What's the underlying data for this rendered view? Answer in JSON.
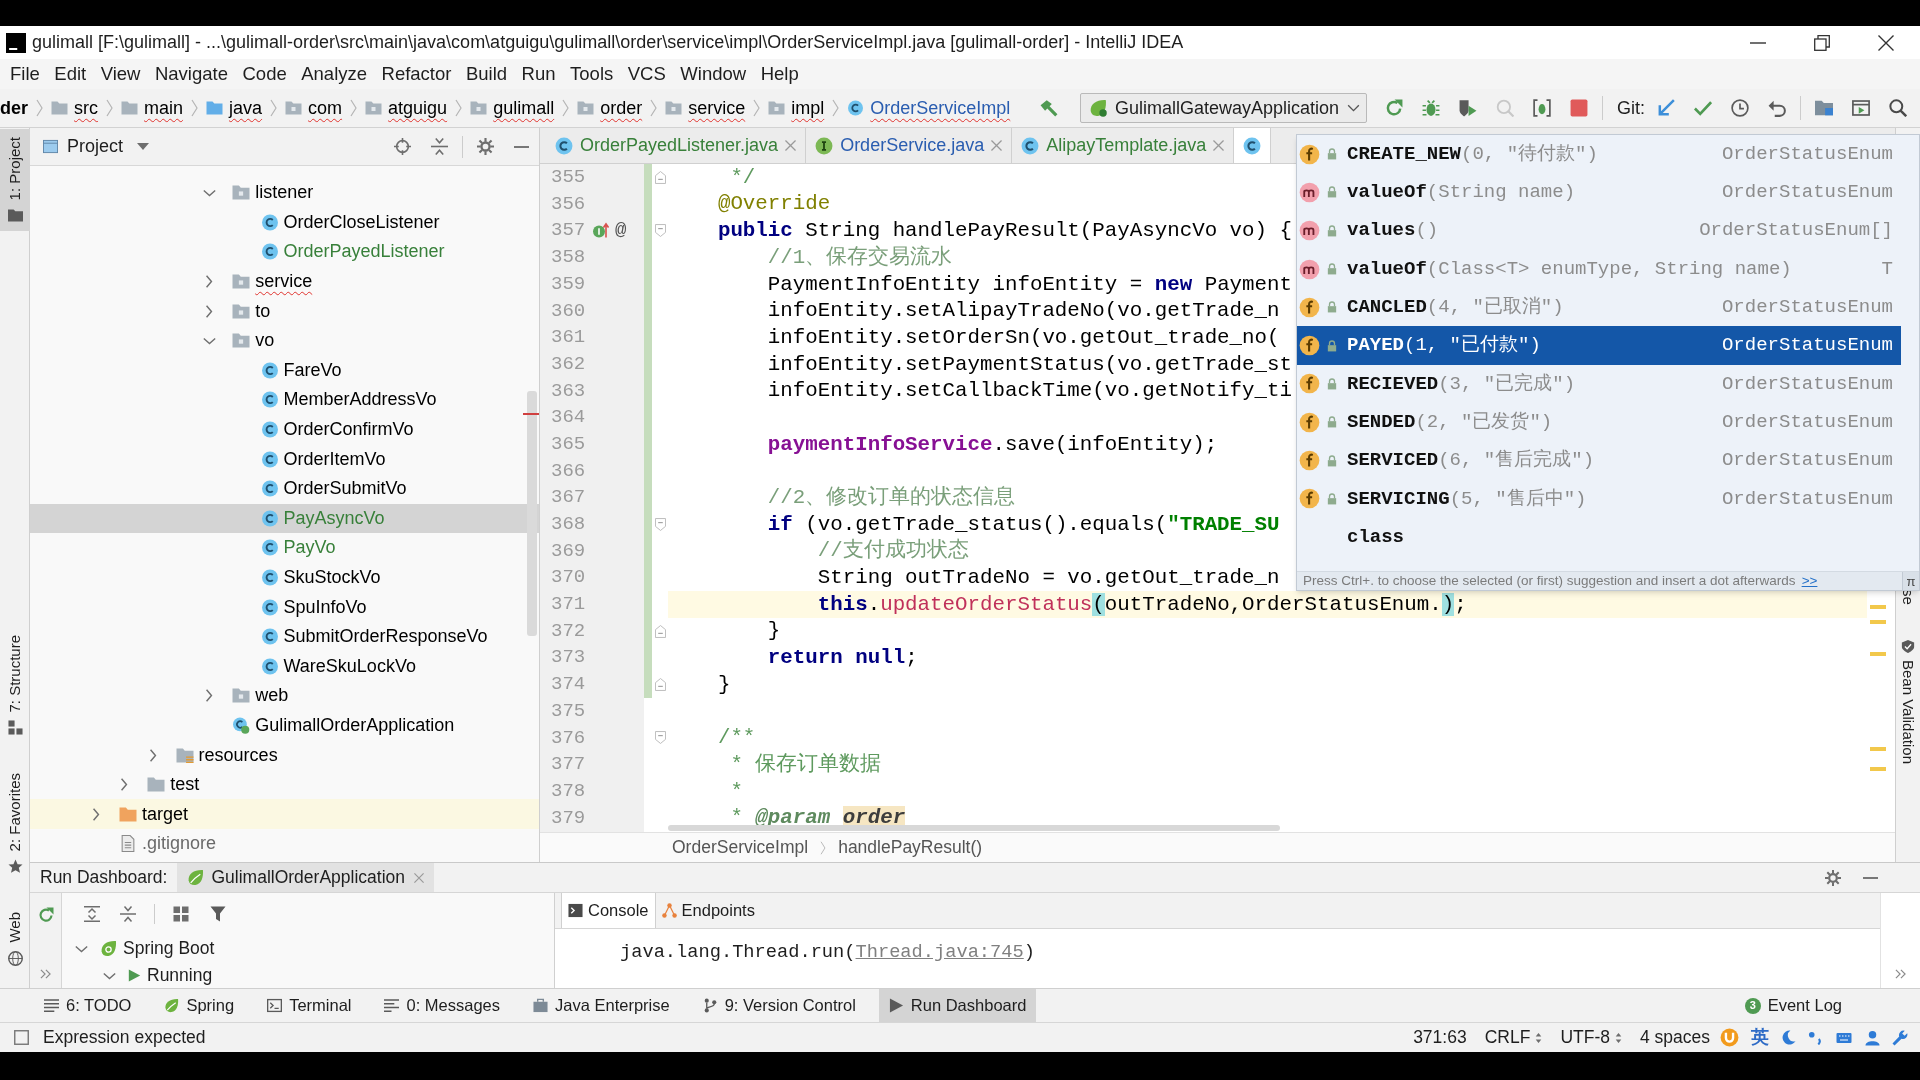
{
  "window": {
    "title": "gulimall [F:\\gulimall] - ...\\gulimall-order\\src\\main\\java\\com\\atguigu\\gulimall\\order\\service\\impl\\OrderServiceImpl.java [gulimall-order] - IntelliJ IDEA"
  },
  "menu": [
    "File",
    "Edit",
    "View",
    "Navigate",
    "Code",
    "Analyze",
    "Refactor",
    "Build",
    "Run",
    "Tools",
    "VCS",
    "Window",
    "Help"
  ],
  "navigation_bar": [
    {
      "label": "der",
      "kind": "module",
      "error": false,
      "color": "#000000"
    },
    {
      "label": "src",
      "kind": "folder",
      "error": true,
      "color": "#000000"
    },
    {
      "label": "main",
      "kind": "folder",
      "error": true,
      "color": "#000000"
    },
    {
      "label": "java",
      "kind": "source_folder",
      "error": true,
      "color": "#000000"
    },
    {
      "label": "com",
      "kind": "package",
      "error": true,
      "color": "#000000"
    },
    {
      "label": "atguigu",
      "kind": "package",
      "error": true,
      "color": "#000000"
    },
    {
      "label": "gulimall",
      "kind": "package",
      "error": true,
      "color": "#000000"
    },
    {
      "label": "order",
      "kind": "package",
      "error": true,
      "color": "#000000"
    },
    {
      "label": "service",
      "kind": "package",
      "error": true,
      "color": "#000000"
    },
    {
      "label": "impl",
      "kind": "package",
      "error": true,
      "color": "#000000"
    },
    {
      "label": "OrderServiceImpl",
      "kind": "class",
      "error": true,
      "color": "#2a5db0"
    }
  ],
  "toolbar": {
    "run_configuration": "GulimallGatewayApplication",
    "run_buttons": [
      {
        "kind": "rerun",
        "disabled": false
      },
      {
        "kind": "debug",
        "disabled": false
      },
      {
        "kind": "coverage",
        "disabled": false
      },
      {
        "kind": "profile",
        "disabled": true
      },
      {
        "kind": "attach",
        "disabled": false
      },
      {
        "kind": "stop",
        "disabled": false
      }
    ],
    "vcs_label": "Git:",
    "vcs_buttons": [
      {
        "kind": "update"
      },
      {
        "kind": "commit"
      },
      {
        "kind": "history"
      },
      {
        "kind": "rollback"
      }
    ],
    "tool_buttons": [
      {
        "kind": "project_structure"
      },
      {
        "kind": "presentation"
      },
      {
        "kind": "search"
      }
    ]
  },
  "left_strip": [
    {
      "label": "1: Project",
      "kind": "project",
      "selected": true
    },
    {
      "label": "7: Structure",
      "kind": "structure",
      "selected": false
    },
    {
      "label": "2: Favorites",
      "kind": "favorites",
      "selected": false
    },
    {
      "label": "Web",
      "kind": "web",
      "selected": false
    }
  ],
  "project_panel": {
    "title": "Project",
    "tree": [
      {
        "children": [
          {
            "children": [
              {
                "children": [
                  {
                    "children": [
                      {
                        "label": "listener",
                        "kind": "package",
                        "expanded": true,
                        "selected": false,
                        "error": false,
                        "color": "#000000",
                        "children": [
                          {
                            "label": "OrderCloseListener",
                            "kind": "class",
                            "selected": false,
                            "error": false,
                            "color": "#000000"
                          },
                          {
                            "label": "OrderPayedListener",
                            "kind": "class",
                            "selected": false,
                            "error": false,
                            "color": "#38803a"
                          }
                        ]
                      },
                      {
                        "label": "service",
                        "kind": "package",
                        "expanded": false,
                        "selected": false,
                        "error": true,
                        "color": "#000000"
                      },
                      {
                        "label": "to",
                        "kind": "package",
                        "expanded": false,
                        "selected": false,
                        "error": false,
                        "color": "#000000"
                      },
                      {
                        "label": "vo",
                        "kind": "package",
                        "expanded": true,
                        "selected": false,
                        "error": false,
                        "color": "#000000",
                        "children": [
                          {
                            "label": "FareVo",
                            "kind": "class",
                            "selected": false,
                            "error": false,
                            "color": "#000000"
                          },
                          {
                            "label": "MemberAddressVo",
                            "kind": "class",
                            "selected": false,
                            "error": false,
                            "color": "#000000"
                          },
                          {
                            "label": "OrderConfirmVo",
                            "kind": "class",
                            "selected": false,
                            "error": false,
                            "color": "#000000"
                          },
                          {
                            "label": "OrderItemVo",
                            "kind": "class",
                            "selected": false,
                            "error": false,
                            "color": "#000000"
                          },
                          {
                            "label": "OrderSubmitVo",
                            "kind": "class",
                            "selected": false,
                            "error": false,
                            "color": "#000000"
                          },
                          {
                            "label": "PayAsyncVo",
                            "kind": "class",
                            "selected": true,
                            "error": false,
                            "color": "#38803a"
                          },
                          {
                            "label": "PayVo",
                            "kind": "class",
                            "selected": false,
                            "error": false,
                            "color": "#38803a"
                          },
                          {
                            "label": "SkuStockVo",
                            "kind": "class",
                            "selected": false,
                            "error": false,
                            "color": "#000000"
                          },
                          {
                            "label": "SpuInfoVo",
                            "kind": "class",
                            "selected": false,
                            "error": false,
                            "color": "#000000"
                          },
                          {
                            "label": "SubmitOrderResponseVo",
                            "kind": "class",
                            "selected": false,
                            "error": false,
                            "color": "#000000"
                          },
                          {
                            "label": "WareSkuLockVo",
                            "kind": "class",
                            "selected": false,
                            "error": false,
                            "color": "#000000"
                          }
                        ]
                      },
                      {
                        "label": "web",
                        "kind": "package",
                        "expanded": false,
                        "selected": false,
                        "error": false,
                        "color": "#000000"
                      },
                      {
                        "label": "GulimallOrderApplication",
                        "kind": "spring_app",
                        "selected": false,
                        "error": false,
                        "color": "#000000"
                      }
                    ]
                  }
                ]
              },
              {
                "label": "resources",
                "kind": "resources_folder",
                "expanded": false,
                "selected": false,
                "error": false,
                "color": "#000000"
              }
            ]
          },
          {
            "label": "test",
            "kind": "folder",
            "expanded": false,
            "selected": false,
            "error": false,
            "color": "#000000"
          }
        ]
      },
      {
        "label": "target",
        "kind": "excluded_folder",
        "expanded": false,
        "selected": false,
        "error": false,
        "color": "#000000"
      },
      {
        "label": ".gitignore",
        "kind": "file",
        "selected": false,
        "error": false,
        "color": "#6a6a6a"
      }
    ]
  },
  "editor": {
    "tabs": [
      {
        "label": "OrderPayedListener.java",
        "kind": "class",
        "selected": false,
        "color": "#38803a"
      },
      {
        "label": "OrderService.java",
        "kind": "interface",
        "selected": false,
        "color": "#2a5db0"
      },
      {
        "label": "AlipayTemplate.java",
        "kind": "class",
        "selected": false,
        "color": "#38803a"
      },
      {
        "kind": "class",
        "selected": true
      }
    ],
    "lines": [
      {
        "number": "355",
        "changed": true,
        "current": false,
        "fold": {
          "kind": "end"
        },
        "tokens": [
          {
            "text": "     */",
            "kind": "doc"
          }
        ]
      },
      {
        "number": "356",
        "changed": true,
        "current": false,
        "tokens": [
          {
            "text": "    @Override",
            "kind": "annotation"
          }
        ]
      },
      {
        "number": "357",
        "changed": true,
        "current": false,
        "fold": {
          "kind": "start"
        },
        "gutter": [
          {
            "kind": "implements"
          },
          {
            "kind": "symbol",
            "text": "@"
          }
        ],
        "tokens": [
          {
            "text": "    public",
            "kind": "keyword"
          },
          {
            "text": " String handlePayResult(PayAsyncVo vo) {",
            "kind": "plain"
          }
        ]
      },
      {
        "number": "358",
        "changed": true,
        "current": false,
        "tokens": [
          {
            "text": "        //1、保存交易流水",
            "kind": "comment"
          }
        ]
      },
      {
        "number": "359",
        "changed": true,
        "current": false,
        "tokens": [
          {
            "text": "        PaymentInfoEntity infoEntity = ",
            "kind": "plain"
          },
          {
            "text": "new",
            "kind": "keyword"
          },
          {
            "text": " Payment",
            "kind": "plain"
          }
        ]
      },
      {
        "number": "360",
        "changed": true,
        "current": false,
        "tokens": [
          {
            "text": "        infoEntity.setAlipayTradeNo(vo.getTrade_n",
            "kind": "plain"
          }
        ]
      },
      {
        "number": "361",
        "changed": true,
        "current": false,
        "tokens": [
          {
            "text": "        infoEntity.setOrderSn(vo.getOut_trade_no(",
            "kind": "plain"
          }
        ]
      },
      {
        "number": "362",
        "changed": true,
        "current": false,
        "tokens": [
          {
            "text": "        infoEntity.setPaymentStatus(vo.getTrade_st",
            "kind": "plain"
          }
        ]
      },
      {
        "number": "363",
        "changed": true,
        "current": false,
        "tokens": [
          {
            "text": "        infoEntity.setCallbackTime(vo.getNotify_ti",
            "kind": "plain"
          }
        ]
      },
      {
        "number": "364",
        "changed": true,
        "current": false
      },
      {
        "number": "365",
        "changed": true,
        "current": false,
        "tokens": [
          {
            "text": "        paymentInfoService",
            "kind": "field"
          },
          {
            "text": ".save(infoEntity);",
            "kind": "plain"
          }
        ]
      },
      {
        "number": "366",
        "changed": true,
        "current": false
      },
      {
        "number": "367",
        "changed": true,
        "current": false,
        "tokens": [
          {
            "text": "        //2、修改订单的状态信息",
            "kind": "comment"
          }
        ]
      },
      {
        "number": "368",
        "changed": true,
        "current": false,
        "fold": {
          "kind": "start"
        },
        "tokens": [
          {
            "text": "        if",
            "kind": "keyword"
          },
          {
            "text": " (vo.getTrade_status().equals(",
            "kind": "plain"
          },
          {
            "text": "\"TRADE_SU",
            "kind": "string"
          }
        ]
      },
      {
        "number": "369",
        "changed": true,
        "current": false,
        "tokens": [
          {
            "text": "            //支付成功状态",
            "kind": "comment"
          }
        ]
      },
      {
        "number": "370",
        "changed": true,
        "current": false,
        "tokens": [
          {
            "text": "            String outTradeNo = vo.getOut_trade_n",
            "kind": "plain"
          }
        ]
      },
      {
        "number": "371",
        "changed": true,
        "current": true,
        "tokens": [
          {
            "text": "            this",
            "kind": "keyword"
          },
          {
            "text": ".",
            "kind": "plain"
          },
          {
            "text": "updateOrderStatus",
            "kind": "call"
          },
          {
            "text": "(",
            "kind": "match"
          },
          {
            "text": "outTradeNo,OrderStatusEnum.",
            "kind": "plain"
          },
          {
            "text": ")",
            "kind": "match"
          },
          {
            "text": ";",
            "kind": "plain"
          }
        ]
      },
      {
        "number": "372",
        "changed": true,
        "current": false,
        "fold": {
          "kind": "end"
        },
        "tokens": [
          {
            "text": "        }",
            "kind": "plain"
          }
        ]
      },
      {
        "number": "373",
        "changed": true,
        "current": false,
        "tokens": [
          {
            "text": "        return",
            "kind": "keyword"
          },
          {
            "text": " null",
            "kind": "keyword"
          },
          {
            "text": ";",
            "kind": "plain"
          }
        ]
      },
      {
        "number": "374",
        "changed": true,
        "current": false,
        "fold": {
          "kind": "end"
        },
        "tokens": [
          {
            "text": "    }",
            "kind": "plain"
          }
        ]
      },
      {
        "number": "375",
        "changed": false,
        "current": false
      },
      {
        "number": "376",
        "changed": false,
        "current": false,
        "fold": {
          "kind": "start"
        },
        "tokens": [
          {
            "text": "    /**",
            "kind": "doc"
          }
        ]
      },
      {
        "number": "377",
        "changed": false,
        "current": false,
        "tokens": [
          {
            "text": "     * 保存订单数据",
            "kind": "doc"
          }
        ]
      },
      {
        "number": "378",
        "changed": false,
        "current": false,
        "tokens": [
          {
            "text": "     *",
            "kind": "doc"
          }
        ]
      },
      {
        "number": "379",
        "changed": false,
        "current": false,
        "tokens": [
          {
            "text": "     * ",
            "kind": "doc"
          },
          {
            "text": "@param ",
            "kind": "doctag"
          },
          {
            "text": "order",
            "kind": "docparam"
          }
        ]
      }
    ],
    "breadcrumb": [
      "OrderServiceImpl",
      "handlePayResult()"
    ]
  },
  "completion": {
    "items": [
      {
        "name": "CREATE_NEW",
        "detail": "(0, \"待付款\")",
        "type": "OrderStatusEnum",
        "kind": "field",
        "selected": false
      },
      {
        "name": "valueOf",
        "detail": "(String name)",
        "type": "OrderStatusEnum",
        "kind": "method",
        "selected": false
      },
      {
        "name": "values",
        "detail": "()",
        "type": "OrderStatusEnum[]",
        "kind": "method",
        "selected": false
      },
      {
        "name": "valueOf",
        "detail": "(Class<T> enumType, String name)",
        "type": "T",
        "kind": "method",
        "selected": false
      },
      {
        "name": "CANCLED",
        "detail": "(4, \"已取消\")",
        "type": "OrderStatusEnum",
        "kind": "field",
        "selected": false
      },
      {
        "name": "PAYED",
        "detail": "(1, \"已付款\")",
        "type": "OrderStatusEnum",
        "kind": "field",
        "selected": true
      },
      {
        "name": "RECIEVED",
        "detail": "(3, \"已完成\")",
        "type": "OrderStatusEnum",
        "kind": "field",
        "selected": false
      },
      {
        "name": "SENDED",
        "detail": "(2, \"已发货\")",
        "type": "OrderStatusEnum",
        "kind": "field",
        "selected": false
      },
      {
        "name": "SERVICED",
        "detail": "(6, \"售后完成\")",
        "type": "OrderStatusEnum",
        "kind": "field",
        "selected": false
      },
      {
        "name": "SERVICING",
        "detail": "(5, \"售后中\")",
        "type": "OrderStatusEnum",
        "kind": "field",
        "selected": false
      },
      {
        "name": "class",
        "kind": "keyword",
        "selected": false
      }
    ],
    "hint": "Press Ctrl+. to choose the selected (or first) suggestion and insert a dot afterwards",
    "hint_link": ">>",
    "corner_button": "π"
  },
  "right_strip": [
    {
      "label": "se",
      "kind": "cut"
    },
    {
      "label": "Bean Validation",
      "kind": "bean_validation"
    }
  ],
  "run_dashboard": {
    "title": "Run Dashboard:",
    "tabs": [
      {
        "label": "GulimallOrderApplication",
        "selected": true
      }
    ],
    "tree": [
      {
        "label": "Spring Boot",
        "kind": "spring_boot",
        "expanded": true,
        "children": [
          {
            "label": "Running",
            "kind": "running",
            "expanded": true
          }
        ]
      }
    ],
    "console_tabs": [
      {
        "label": "Console",
        "kind": "console",
        "selected": true
      },
      {
        "label": "Endpoints",
        "kind": "endpoints",
        "selected": false
      }
    ],
    "console_lines": [
      {
        "text": "java.lang.Thread.run(",
        "link": "Thread.java:745",
        "tail": ")"
      }
    ]
  },
  "tool_windows": [
    {
      "label": "6: TODO",
      "kind": "todo",
      "selected": false
    },
    {
      "label": "Spring",
      "kind": "spring",
      "selected": false
    },
    {
      "label": "Terminal",
      "kind": "terminal",
      "selected": false
    },
    {
      "label": "0: Messages",
      "kind": "messages",
      "selected": false
    },
    {
      "label": "Java Enterprise",
      "kind": "java_enterprise",
      "selected": false
    },
    {
      "label": "9: Version Control",
      "kind": "version_control",
      "selected": false
    },
    {
      "label": "Run Dashboard",
      "kind": "run_dashboard",
      "selected": true
    }
  ],
  "event_log": {
    "label": "Event Log",
    "count": "3"
  },
  "status_bar": {
    "message": "Expression expected",
    "position": "371:63",
    "line_separator": "CRLF",
    "encoding": "UTF-8",
    "indent": "4 spaces",
    "input_method": "英"
  }
}
